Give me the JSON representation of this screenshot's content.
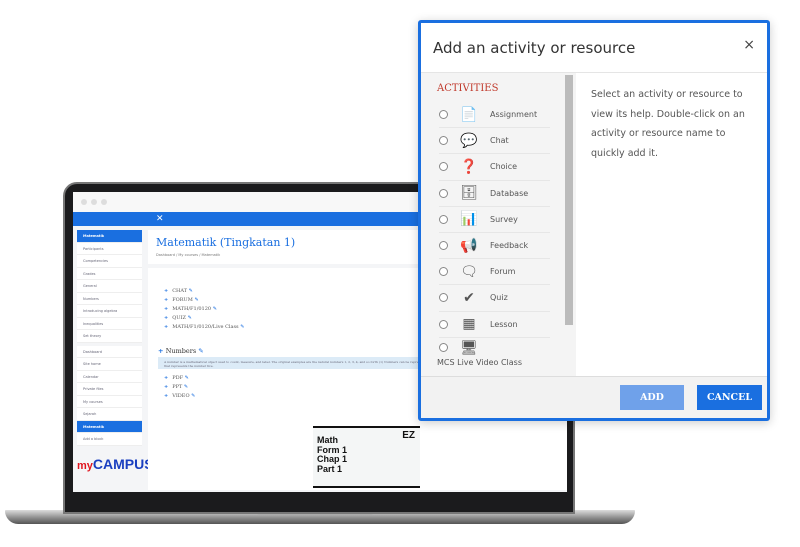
{
  "laptop": {
    "close_glyph": "✕",
    "sidebar": [
      "Matematik",
      "Participants",
      "Competencies",
      "Grades",
      "General",
      "Numbers",
      "Introducing algebra",
      "Inequalities",
      "Set theory",
      "Dashboard",
      "Site home",
      "Calendar",
      "Private files",
      "My courses",
      "Sejarah",
      "Matematik",
      "Add a block"
    ],
    "logo": {
      "my": "my",
      "campus": "CAMPUS"
    },
    "course_title": "Matematik (Tingkatan 1)",
    "breadcrumb": "Dashboard / My courses / Matematik",
    "activities": [
      "CHAT",
      "FORUM",
      "MATH/F1/0120",
      "QUIZ",
      "MATH/F1/0120/Live Class"
    ],
    "section_title": "Numbers",
    "section_desc": "A number is a mathematical object used to count, measure, and label. The original examples are the natural numbers 1, 2, 3, 4, and so forth (1) Numbers can be represented in language with number words, called numerals; for example, \"5\" is a numeral that represents the number five.",
    "resources": [
      "PDF",
      "PPT",
      "VIDEO"
    ],
    "video": {
      "line1": "Math",
      "line2": "Form 1",
      "line3": "Chap 1",
      "line4": "Part 1",
      "brand": "EZ"
    }
  },
  "modal": {
    "title": "Add an activity or resource",
    "close": "×",
    "section": "ACTIVITIES",
    "items": [
      {
        "label": "Assignment",
        "icon": "assignment-icon",
        "glyph": "📄"
      },
      {
        "label": "Chat",
        "icon": "chat-icon",
        "glyph": "💬"
      },
      {
        "label": "Choice",
        "icon": "question-icon",
        "glyph": "❓"
      },
      {
        "label": "Database",
        "icon": "database-icon",
        "glyph": "🗄"
      },
      {
        "label": "Survey",
        "icon": "bar-chart-icon",
        "glyph": "📊"
      },
      {
        "label": "Feedback",
        "icon": "megaphone-icon",
        "glyph": "📢"
      },
      {
        "label": "Forum",
        "icon": "forum-icon",
        "glyph": "🗨"
      },
      {
        "label": "Quiz",
        "icon": "checkmark-icon",
        "glyph": "✔"
      },
      {
        "label": "Lesson",
        "icon": "lesson-icon",
        "glyph": "▦"
      }
    ],
    "last_item": {
      "label": "MCS Live Video Class",
      "icon": "video-class-icon",
      "glyph": "🖥"
    },
    "help": "Select an activity or resource to view its help. Double-click on an activity or resource name to quickly add it.",
    "add": "ADD",
    "cancel": "CANCEL"
  }
}
